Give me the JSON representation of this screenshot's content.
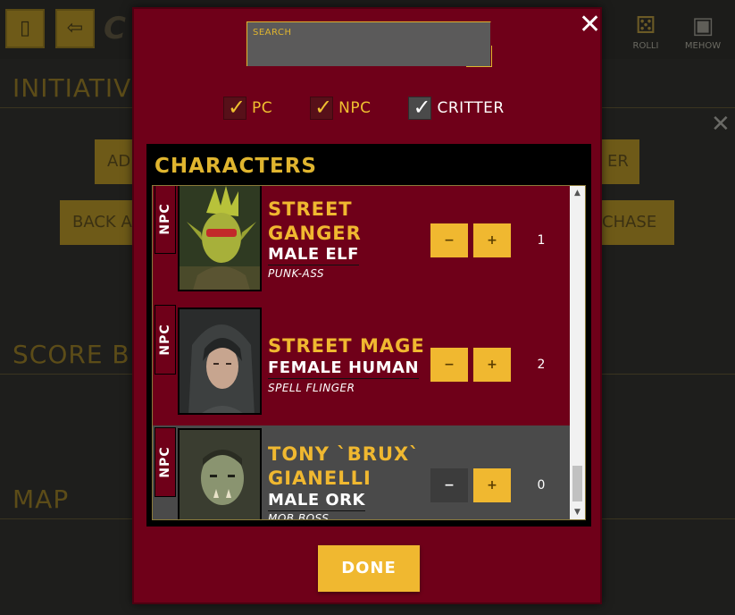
{
  "background": {
    "toolbar": {
      "rolli_label": "ROLLI",
      "mehow_label": "MEHOW"
    },
    "headings": {
      "initiative": "INITIATIV",
      "score": "SCORE B",
      "map": "MAP"
    },
    "buttons": {
      "ad": "AD",
      "back": "BACK A",
      "er": "ER",
      "chase": "CHASE"
    }
  },
  "modal": {
    "close_icon": "close-x-icon",
    "search": {
      "label": "SEARCH",
      "value": "",
      "placeholder": ""
    },
    "filters": [
      {
        "label": "PC",
        "checked": true
      },
      {
        "label": "NPC",
        "checked": true
      },
      {
        "label": "CRITTER",
        "checked": true
      }
    ],
    "panel_title": "CHARACTERS",
    "characters": [
      {
        "type": "NPC",
        "name_line1": "STREET",
        "name_line2": "GANGER",
        "description": "MALE ELF",
        "subtitle": "PUNK-ASS",
        "minus": "−",
        "plus": "+",
        "count": "1",
        "active": false
      },
      {
        "type": "NPC",
        "name_line1": "STREET MAGE",
        "name_line2": "",
        "description": "FEMALE HUMAN",
        "subtitle": "SPELL FLINGER",
        "minus": "−",
        "plus": "+",
        "count": "2",
        "active": false
      },
      {
        "type": "NPC",
        "name_line1": "TONY `BRUX`",
        "name_line2": "GIANELLI",
        "description": "MALE ORK",
        "subtitle": "MOB BOSS",
        "minus": "−",
        "plus": "+",
        "count": "0",
        "active": true
      }
    ],
    "done_label": "DONE"
  },
  "colors": {
    "modal_bg": "#6f0019",
    "accent": "#f0b830",
    "active_row": "#4a4a4a"
  }
}
